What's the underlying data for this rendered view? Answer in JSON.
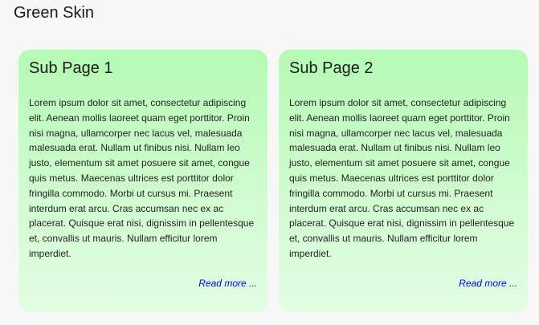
{
  "page": {
    "title": "Green Skin"
  },
  "cards": [
    {
      "title": "Sub Page 1",
      "body": "Lorem ipsum dolor sit amet, consectetur adipiscing elit. Aenean mollis laoreet quam eget porttitor. Proin nisi magna, ullamcorper nec lacus vel, malesuada malesuada erat. Nullam ut finibus nisi. Nullam leo justo, elementum sit amet posuere sit amet, congue quis metus. Maecenas ultrices est porttitor dolor fringilla commodo. Morbi ut cursus mi. Praesent interdum erat arcu. Cras accumsan nec ex ac placerat. Quisque erat nisi, dignissim in pellentesque et, convallis ut mauris. Nullam efficitur lorem imperdiet.",
      "link": "Read more ..."
    },
    {
      "title": "Sub Page 2",
      "body": "Lorem ipsum dolor sit amet, consectetur adipiscing elit. Aenean mollis laoreet quam eget porttitor. Proin nisi magna, ullamcorper nec lacus vel, malesuada malesuada erat. Nullam ut finibus nisi. Nullam leo justo, elementum sit amet posuere sit amet, congue quis metus. Maecenas ultrices est porttitor dolor fringilla commodo. Morbi ut cursus mi. Praesent interdum erat arcu. Cras accumsan nec ex ac placerat. Quisque erat nisi, dignissim in pellentesque et, convallis ut mauris. Nullam efficitur lorem imperdiet.",
      "link": "Read more ..."
    }
  ],
  "colors": {
    "page_background": "#f7f7f7",
    "card_gradient_top": "#b4fab4",
    "card_gradient_bottom": "#e3fde3",
    "link": "#0000ee",
    "text": "#222222"
  }
}
